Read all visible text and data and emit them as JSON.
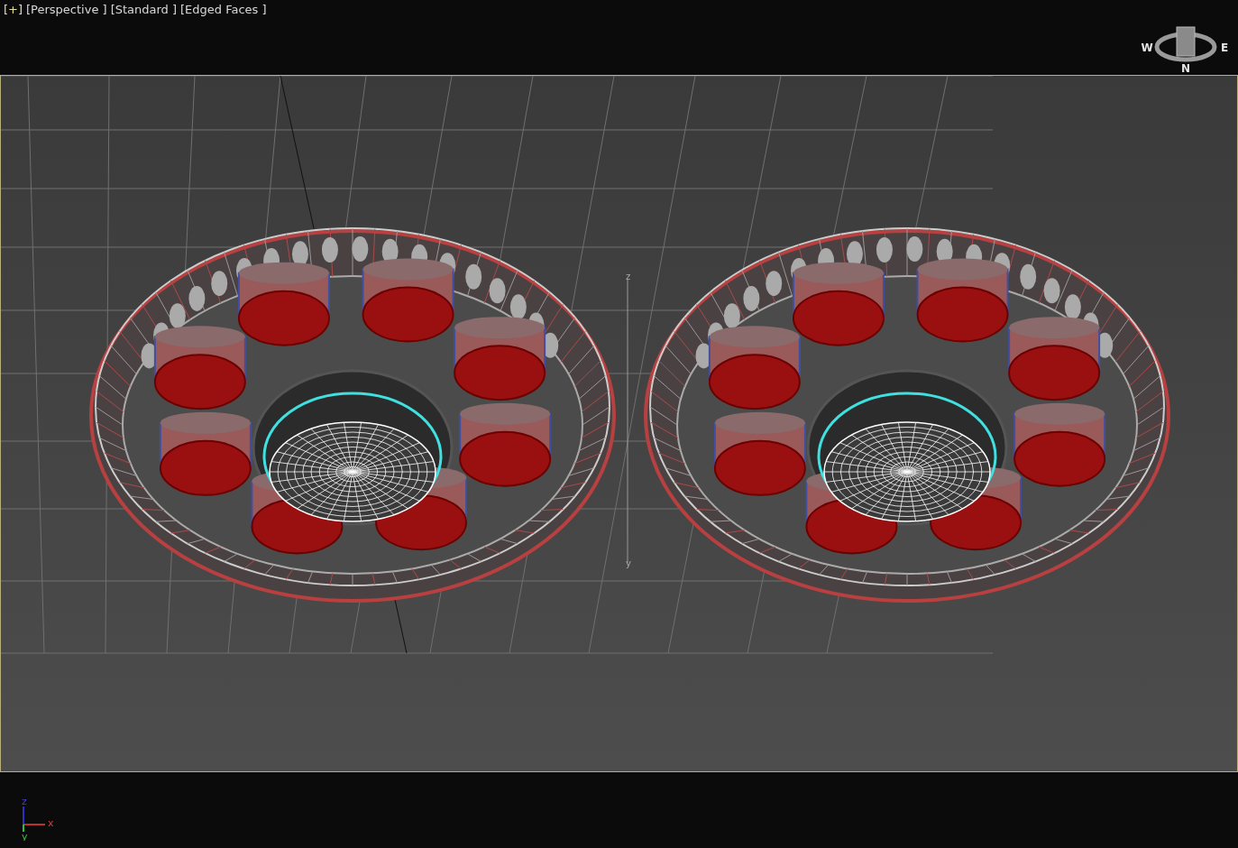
{
  "viewport_labels": [
    {
      "text": "[+]",
      "highlighted": true
    },
    {
      "text": "[Perspective ]",
      "highlighted": false
    },
    {
      "text": "[Standard ]",
      "highlighted": false
    },
    {
      "text": "[Edged Faces ]",
      "highlighted": false
    }
  ],
  "view_cube": {
    "compass": [
      "W",
      "E",
      "N"
    ]
  },
  "scene_axis_labels": [
    "z",
    "y"
  ],
  "axis_gizmo": {
    "z": "z",
    "x": "x",
    "y": "y"
  }
}
